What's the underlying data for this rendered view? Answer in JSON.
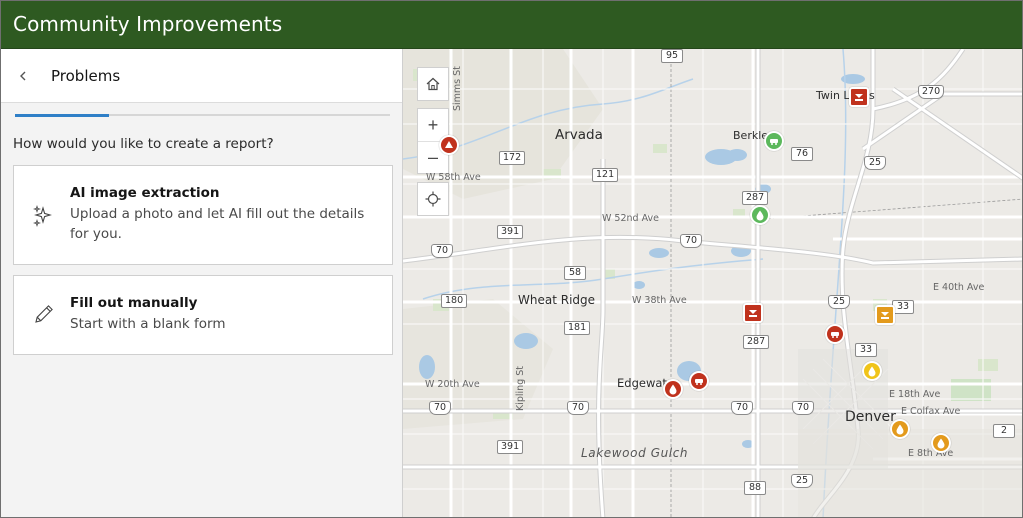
{
  "app": {
    "title": "Community Improvements"
  },
  "panel": {
    "title": "Problems",
    "prompt": "How would you like to create a report?",
    "options": [
      {
        "title": "AI image extraction",
        "description": "Upload a photo and let AI fill out the details for you.",
        "icon": "sparkles-icon"
      },
      {
        "title": "Fill out manually",
        "description": "Start with a blank form",
        "icon": "pencil-icon"
      }
    ]
  },
  "map": {
    "controls": {
      "home": "home-icon",
      "zoom_in": "+",
      "zoom_out": "–",
      "locate": "locate-icon"
    },
    "places": [
      {
        "name": "Arvada"
      },
      {
        "name": "Wheat Ridge"
      },
      {
        "name": "Edgewater"
      },
      {
        "name": "Denver"
      },
      {
        "name": "Berkley"
      },
      {
        "name": "Twin Lakes"
      },
      {
        "name": "Lakewood Gulch"
      }
    ],
    "streets": [
      {
        "name": "W 58th Ave"
      },
      {
        "name": "W 52nd Ave"
      },
      {
        "name": "W 38th Ave"
      },
      {
        "name": "W 20th Ave"
      },
      {
        "name": "E 40th Ave"
      },
      {
        "name": "E 18th Ave"
      },
      {
        "name": "E Colfax Ave"
      },
      {
        "name": "E 8th Ave"
      },
      {
        "name": "Kipling St"
      },
      {
        "name": "Simms St"
      }
    ],
    "shields": [
      {
        "label": "95"
      },
      {
        "label": "270"
      },
      {
        "label": "172"
      },
      {
        "label": "76"
      },
      {
        "label": "25"
      },
      {
        "label": "121"
      },
      {
        "label": "287"
      },
      {
        "label": "391"
      },
      {
        "label": "70"
      },
      {
        "label": "70"
      },
      {
        "label": "58"
      },
      {
        "label": "180"
      },
      {
        "label": "181"
      },
      {
        "label": "25"
      },
      {
        "label": "33"
      },
      {
        "label": "287"
      },
      {
        "label": "33"
      },
      {
        "label": "70"
      },
      {
        "label": "70"
      },
      {
        "label": "70"
      },
      {
        "label": "70"
      },
      {
        "label": "391"
      },
      {
        "label": "88"
      },
      {
        "label": "25"
      },
      {
        "label": "2"
      }
    ],
    "colors": {
      "red": "#c0321d",
      "green": "#5cb85c",
      "orange": "#e39a1c",
      "yellow": "#f0c419"
    }
  }
}
